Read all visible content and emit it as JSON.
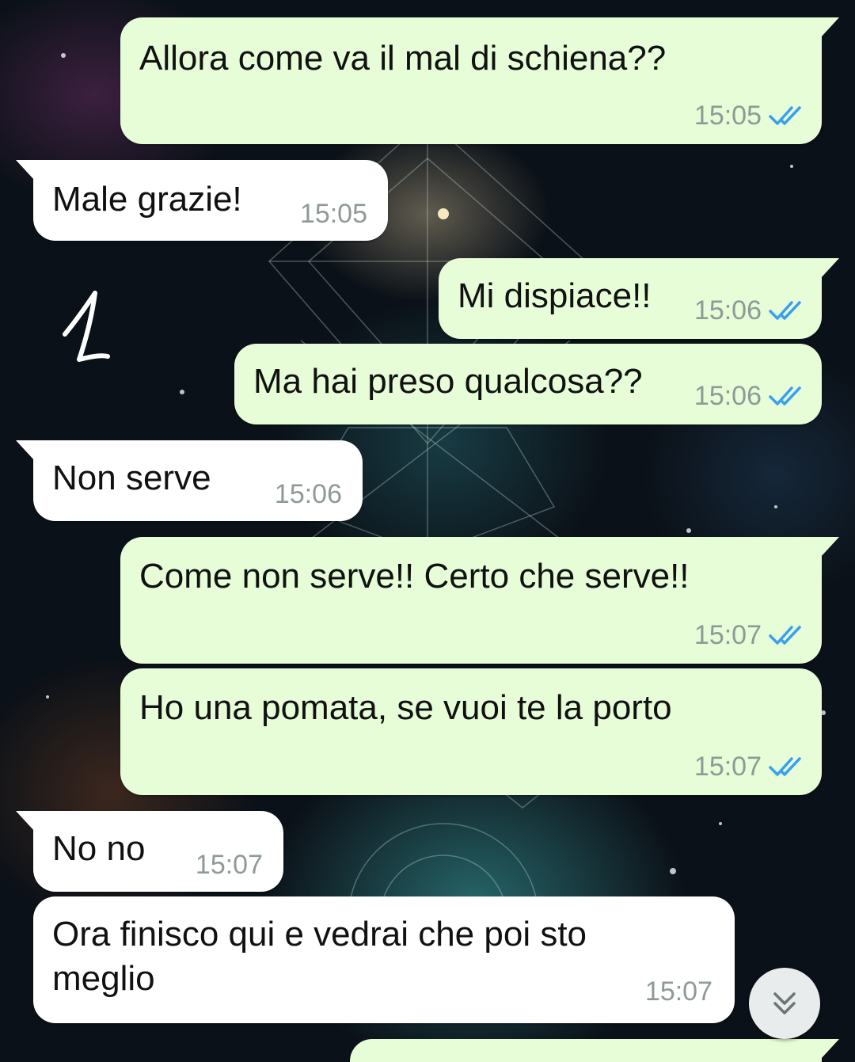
{
  "messages": [
    {
      "text": "Allora come va il mal di schiena??",
      "time": "15:05",
      "direction": "out",
      "status": "read"
    },
    {
      "text": "Male grazie!",
      "time": "15:05",
      "direction": "in"
    },
    {
      "text": "Mi dispiace!!",
      "time": "15:06",
      "direction": "out",
      "status": "read"
    },
    {
      "text": "Ma hai preso qualcosa??",
      "time": "15:06",
      "direction": "out",
      "status": "read"
    },
    {
      "text": "Non serve",
      "time": "15:06",
      "direction": "in"
    },
    {
      "text": "Come non serve!! Certo che serve!!",
      "time": "15:07",
      "direction": "out",
      "status": "read"
    },
    {
      "text": "Ho una pomata, se vuoi te la porto",
      "time": "15:07",
      "direction": "out",
      "status": "read"
    },
    {
      "text": "No no",
      "time": "15:07",
      "direction": "in"
    },
    {
      "text": "Ora finisco qui e vedrai che poi sto\nmeglio",
      "time": "15:07",
      "direction": "in"
    }
  ],
  "annotation": {
    "label": "1",
    "color": "#ffffff"
  },
  "colors": {
    "outgoing_bubble": "#e6fdd8",
    "incoming_bubble": "#ffffff",
    "read_ticks": "#3aa0ee",
    "timestamp": "#8f9a96"
  },
  "icons": {
    "read_receipt": "double-check-icon",
    "scroll_down": "double-chevron-down-icon"
  }
}
